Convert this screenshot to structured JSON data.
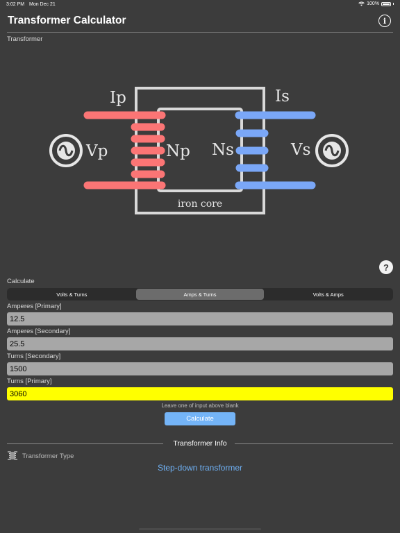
{
  "status_bar": {
    "time": "3:02 PM",
    "date": "Mon Dec 21",
    "battery": "100%"
  },
  "nav": {
    "title": "Transformer Calculator",
    "info_icon": "info-icon"
  },
  "transformer_section": {
    "label": "Transformer",
    "diagram": {
      "primary_current": "Ip",
      "secondary_current": "Is",
      "primary_voltage": "Vp",
      "secondary_voltage": "Vs",
      "primary_turns": "Np",
      "secondary_turns": "Ns",
      "core": "iron core",
      "colors": {
        "primary": "#fb7575",
        "secondary": "#7aa7f7",
        "core": "#d9d9d9"
      }
    }
  },
  "calculate": {
    "label": "Calculate",
    "tabs": [
      "Volts & Turns",
      "Amps & Turns",
      "Volts & Amps"
    ],
    "selected_tab": "Amps & Turns",
    "fields": [
      {
        "label": "Amperes [Primary]",
        "value": "12.5",
        "highlight": false
      },
      {
        "label": "Amperes [Secondary]",
        "value": "25.5",
        "highlight": false
      },
      {
        "label": "Turns [Secondary]",
        "value": "1500",
        "highlight": false
      },
      {
        "label": "Turns [Primary]",
        "value": "3060",
        "highlight": true
      }
    ],
    "hint": "Leave one of input above blank",
    "button_label": "Calculate"
  },
  "info": {
    "header": "Transformer Info",
    "type_label": "Transformer Type",
    "type_value": "Step-down transformer"
  }
}
